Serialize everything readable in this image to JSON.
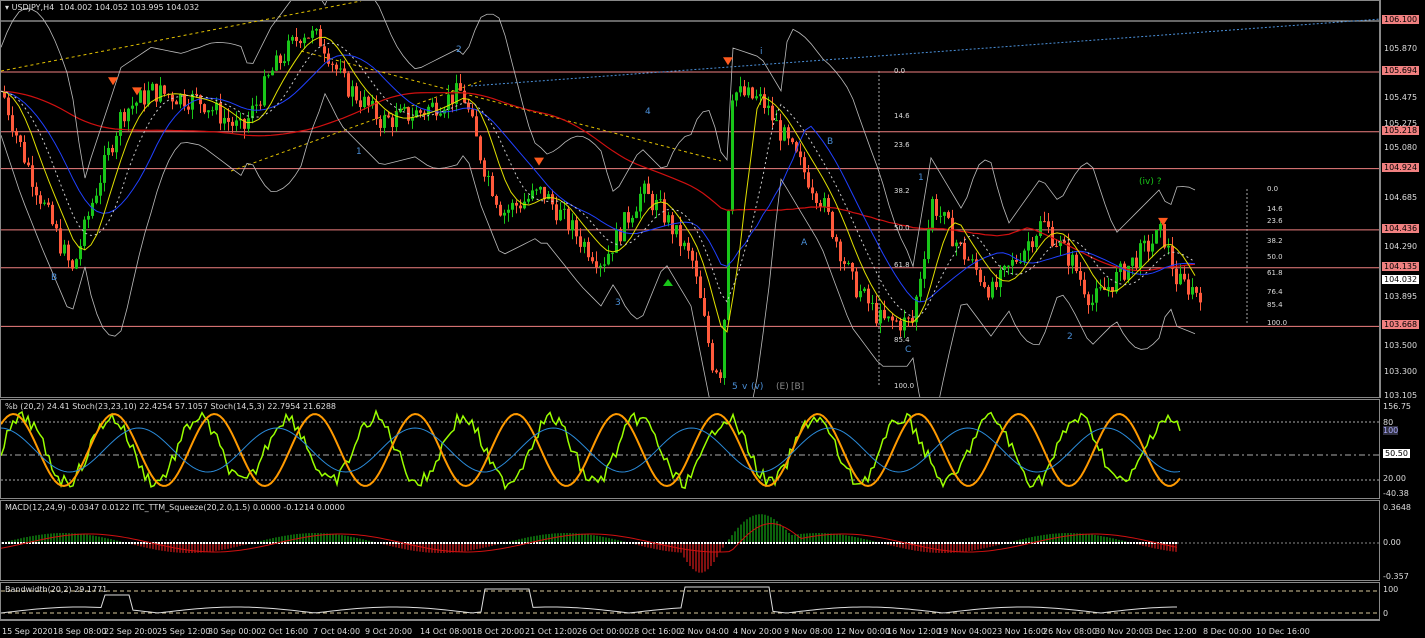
{
  "header": {
    "symbol": "USDJPY,H4",
    "ohlc": "104.002 104.052 103.995 104.032"
  },
  "price_axis": {
    "ticks": [
      "105.870",
      "105.475",
      "105.275",
      "105.080",
      "104.685",
      "104.290",
      "103.895",
      "103.500",
      "103.300",
      "103.105"
    ],
    "levels": [
      "106.100",
      "105.694",
      "105.218",
      "104.924",
      "104.436",
      "104.135",
      "103.668"
    ],
    "current": "104.032"
  },
  "level_values": [
    106.1,
    105.694,
    105.218,
    104.924,
    104.436,
    104.135,
    103.668
  ],
  "price_range": [
    103.105,
    106.1
  ],
  "price_path": [
    [
      0,
      105.54
    ],
    [
      20,
      105.06
    ],
    [
      40,
      104.66
    ],
    [
      70,
      104.1
    ],
    [
      90,
      104.66
    ],
    [
      120,
      105.38
    ],
    [
      150,
      105.54
    ],
    [
      200,
      105.46
    ],
    [
      240,
      105.22
    ],
    [
      270,
      105.7
    ],
    [
      300,
      106.02
    ],
    [
      320,
      105.94
    ],
    [
      340,
      105.62
    ],
    [
      380,
      105.3
    ],
    [
      420,
      105.38
    ],
    [
      460,
      105.54
    ],
    [
      480,
      104.98
    ],
    [
      500,
      104.58
    ],
    [
      540,
      104.74
    ],
    [
      580,
      104.34
    ],
    [
      600,
      104.18
    ],
    [
      640,
      104.74
    ],
    [
      660,
      104.58
    ],
    [
      690,
      104.18
    ],
    [
      710,
      103.38
    ],
    [
      720,
      103.3
    ],
    [
      730,
      105.54
    ],
    [
      760,
      105.46
    ],
    [
      790,
      105.06
    ],
    [
      820,
      104.66
    ],
    [
      850,
      104.02
    ],
    [
      880,
      103.7
    ],
    [
      910,
      103.7
    ],
    [
      930,
      104.66
    ],
    [
      960,
      104.26
    ],
    [
      990,
      103.94
    ],
    [
      1040,
      104.5
    ],
    [
      1070,
      104.18
    ],
    [
      1090,
      103.86
    ],
    [
      1130,
      104.18
    ],
    [
      1160,
      104.42
    ],
    [
      1175,
      104.02
    ],
    [
      1200,
      103.94
    ]
  ],
  "signal_arrows": [
    [
      112,
      105.54
    ],
    [
      136,
      105.46
    ],
    [
      538,
      104.9
    ],
    [
      727,
      105.7
    ],
    [
      1162,
      104.42
    ]
  ],
  "wave_labels": [
    "2",
    "1",
    "B",
    "4",
    "3",
    "i",
    "B",
    "A",
    "C",
    "1",
    "2",
    "(iv) ?",
    "5",
    "v",
    "(v)",
    "(E)",
    "[B]"
  ],
  "fib_left": [
    "0.0",
    "14.6",
    "23.6",
    "38.2",
    "50.0",
    "61.8",
    "85.4",
    "100.0"
  ],
  "fib_right": [
    "0.0",
    "14.6",
    "23.6",
    "38.2",
    "50.0",
    "61.8",
    "76.4",
    "85.4",
    "100.0"
  ],
  "stoch": {
    "label": "%b (20,2) 24.41  Stoch(23,23,10) 22.4254 57.1057  Stoch(14,5,3) 22.7954 21.6288",
    "ticks": [
      "156.75",
      "80",
      "100",
      "50.50",
      "20.00",
      "-40.38"
    ]
  },
  "macd": {
    "label": "MACD(12,24,9) -0.0347 0.0122  ITC_TTM_Squeeze(20,2.0,1.5) 0.0000 -0.1214 0.0000",
    "ticks": [
      "0.3648",
      "0.00",
      "-0.357"
    ]
  },
  "bandwidth": {
    "label": "Bandwidth(20,2) 29.1771",
    "ticks": [
      "100",
      "0"
    ]
  },
  "time_axis": [
    "15 Sep 2020",
    "18 Sep 08:00",
    "22 Sep 20:00",
    "25 Sep 12:00",
    "30 Sep 00:00",
    "2 Oct 16:00",
    "7 Oct 04:00",
    "9 Oct 20:00",
    "14 Oct 08:00",
    "18 Oct 20:00",
    "21 Oct 12:00",
    "26 Oct 00:00",
    "28 Oct 16:00",
    "2 Nov 04:00",
    "4 Nov 20:00",
    "9 Nov 08:00",
    "12 Nov 00:00",
    "16 Nov 12:00",
    "19 Nov 04:00",
    "23 Nov 16:00",
    "26 Nov 08:00",
    "30 Nov 20:00",
    "3 Dec 12:00",
    "8 Dec 00:00",
    "10 Dec 16:00"
  ],
  "colors": {
    "bull": "#19c519",
    "bear": "#ff5a3c",
    "level": "#f08080",
    "ma_red": "#d01010",
    "ma_blue": "#2040ff",
    "ma_yellow": "#e0e000",
    "stoch_green": "#9aff00",
    "stoch_orange": "#ff9a00"
  }
}
